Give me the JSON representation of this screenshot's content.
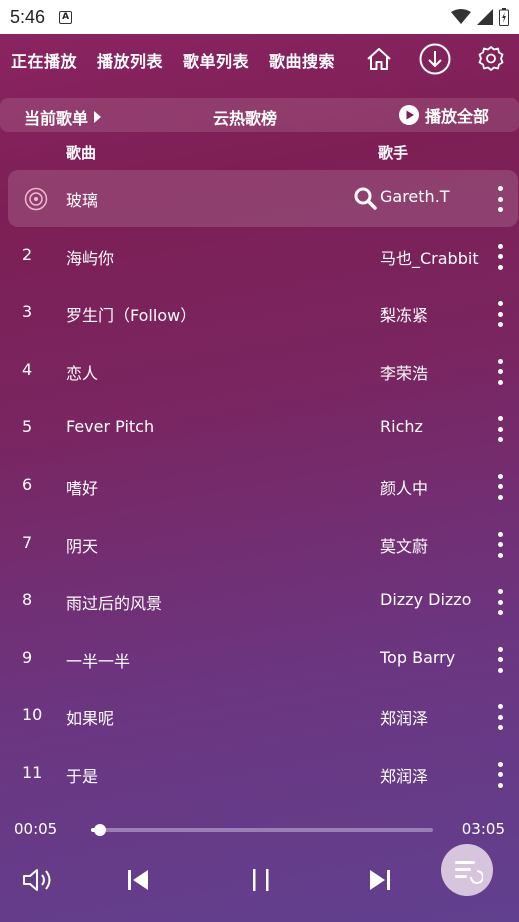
{
  "status": {
    "time": "5:46",
    "notification_icon": "app-notification-icon"
  },
  "nav": {
    "tabs": [
      "正在播放",
      "播放列表",
      "歌单列表",
      "歌曲搜索"
    ],
    "icons": [
      "home-icon",
      "download-icon",
      "settings-icon"
    ]
  },
  "list_header": {
    "current_label": "当前歌单",
    "title": "云热歌榜",
    "play_all_label": "播放全部"
  },
  "columns": {
    "song": "歌曲",
    "artist": "歌手"
  },
  "songs": [
    {
      "num": "",
      "title": "玻璃",
      "artist": "Gareth.T",
      "active": true
    },
    {
      "num": "2",
      "title": "海屿你",
      "artist": "马也_Crabbit"
    },
    {
      "num": "3",
      "title": "罗生门（Follow）",
      "artist": "梨冻紧"
    },
    {
      "num": "4",
      "title": "恋人",
      "artist": "李荣浩"
    },
    {
      "num": "5",
      "title": "Fever Pitch",
      "artist": "Richz"
    },
    {
      "num": "6",
      "title": "嗜好",
      "artist": "颜人中"
    },
    {
      "num": "7",
      "title": "阴天",
      "artist": "莫文蔚"
    },
    {
      "num": "8",
      "title": "雨过后的风景",
      "artist": "Dizzy Dizzo"
    },
    {
      "num": "9",
      "title": "一半一半",
      "artist": "Top Barry"
    },
    {
      "num": "10",
      "title": "如果呢",
      "artist": "郑润泽"
    },
    {
      "num": "11",
      "title": "于是",
      "artist": "郑润泽"
    }
  ],
  "player": {
    "current_time": "00:05",
    "total_time": "03:05",
    "progress_fraction": 0.027
  },
  "colors": {
    "bg_top": "#8a2462",
    "bg_bottom": "#61408f",
    "accent": "#ffffff"
  }
}
